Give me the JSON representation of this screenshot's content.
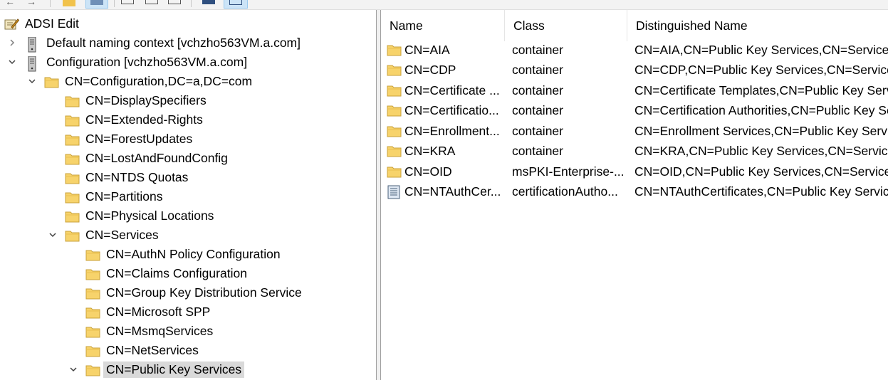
{
  "tree": {
    "items": [
      {
        "label": "ADSI Edit",
        "icon": "adsi-edit-icon"
      },
      {
        "label": "Default naming context [vchzho563VM.a.com]",
        "icon": "server-icon"
      },
      {
        "label": "Configuration [vchzho563VM.a.com]",
        "icon": "server-icon"
      },
      {
        "label": "CN=Configuration,DC=a,DC=com",
        "icon": "folder-icon"
      },
      {
        "label": "CN=DisplaySpecifiers",
        "icon": "folder-icon"
      },
      {
        "label": "CN=Extended-Rights",
        "icon": "folder-icon"
      },
      {
        "label": "CN=ForestUpdates",
        "icon": "folder-icon"
      },
      {
        "label": "CN=LostAndFoundConfig",
        "icon": "folder-icon"
      },
      {
        "label": "CN=NTDS Quotas",
        "icon": "folder-icon"
      },
      {
        "label": "CN=Partitions",
        "icon": "folder-icon"
      },
      {
        "label": "CN=Physical Locations",
        "icon": "folder-icon"
      },
      {
        "label": "CN=Services",
        "icon": "folder-icon"
      },
      {
        "label": "CN=AuthN Policy Configuration",
        "icon": "folder-icon"
      },
      {
        "label": "CN=Claims Configuration",
        "icon": "folder-icon"
      },
      {
        "label": "CN=Group Key Distribution Service",
        "icon": "folder-icon"
      },
      {
        "label": "CN=Microsoft SPP",
        "icon": "folder-icon"
      },
      {
        "label": "CN=MsmqServices",
        "icon": "folder-icon"
      },
      {
        "label": "CN=NetServices",
        "icon": "folder-icon"
      },
      {
        "label": "CN=Public Key Services",
        "icon": "folder-icon",
        "selected": true
      }
    ]
  },
  "list": {
    "columns": [
      "Name",
      "Class",
      "Distinguished Name"
    ],
    "rows": [
      {
        "name": "CN=AIA",
        "class": "container",
        "dn": "CN=AIA,CN=Public Key Services,CN=Services,C",
        "icon": "folder-icon"
      },
      {
        "name": "CN=CDP",
        "class": "container",
        "dn": "CN=CDP,CN=Public Key Services,CN=Services,",
        "icon": "folder-icon"
      },
      {
        "name": "CN=Certificate ...",
        "class": "container",
        "dn": "CN=Certificate Templates,CN=Public Key Servi",
        "icon": "folder-icon"
      },
      {
        "name": "CN=Certificatio...",
        "class": "container",
        "dn": "CN=Certification Authorities,CN=Public Key Se",
        "icon": "folder-icon"
      },
      {
        "name": "CN=Enrollment...",
        "class": "container",
        "dn": "CN=Enrollment Services,CN=Public Key Servic",
        "icon": "folder-icon"
      },
      {
        "name": "CN=KRA",
        "class": "container",
        "dn": "CN=KRA,CN=Public Key Services,CN=Services,",
        "icon": "folder-icon"
      },
      {
        "name": "CN=OID",
        "class": "msPKI-Enterprise-...",
        "dn": "CN=OID,CN=Public Key Services,CN=Services,",
        "icon": "folder-icon"
      },
      {
        "name": "CN=NTAuthCer...",
        "class": "certificationAutho...",
        "dn": "CN=NTAuthCertificates,CN=Public Key Service",
        "icon": "document-icon"
      }
    ]
  }
}
